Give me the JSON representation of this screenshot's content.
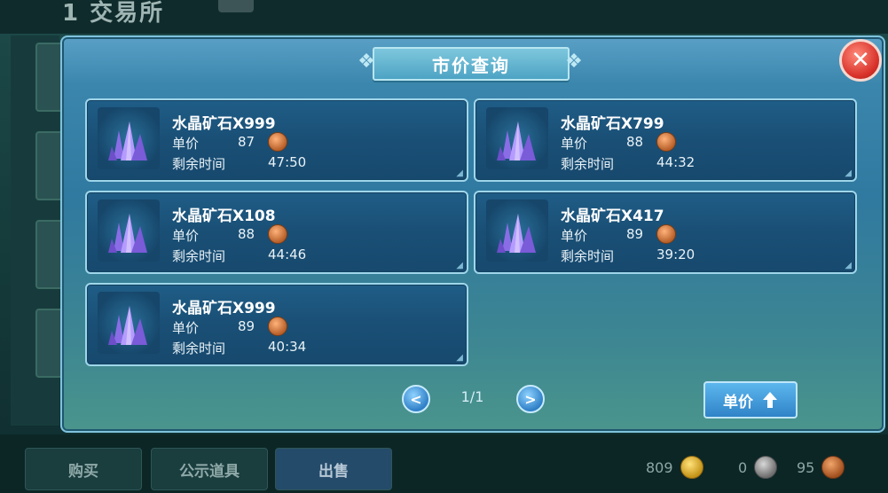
{
  "background": {
    "header_title": "1 交易所",
    "bottom_tabs": [
      "购买",
      "公示道具",
      "出售"
    ],
    "currencies": [
      {
        "amount": "809",
        "icon": "gold-coin-icon"
      },
      {
        "amount": "0",
        "icon": "silver-coin-icon"
      },
      {
        "amount": "95",
        "icon": "bronze-coin-icon"
      }
    ]
  },
  "dialog": {
    "title": "市价查询",
    "close_label": "✕",
    "price_label": "单价",
    "time_label": "剩余时间",
    "listings": [
      {
        "name": "水晶矿石X999",
        "price": "87",
        "time": "47:50"
      },
      {
        "name": "水晶矿石X799",
        "price": "88",
        "time": "44:32"
      },
      {
        "name": "水晶矿石X108",
        "price": "88",
        "time": "44:46"
      },
      {
        "name": "水晶矿石X417",
        "price": "89",
        "time": "39:20"
      },
      {
        "name": "水晶矿石X999",
        "price": "89",
        "time": "40:34"
      }
    ],
    "pager": {
      "prev": "<",
      "page": "1/1",
      "next": ">"
    },
    "sort_button": "单价"
  },
  "colors": {
    "accent": "#3079a0",
    "close": "#d8322a",
    "card": "#1a4f75"
  }
}
